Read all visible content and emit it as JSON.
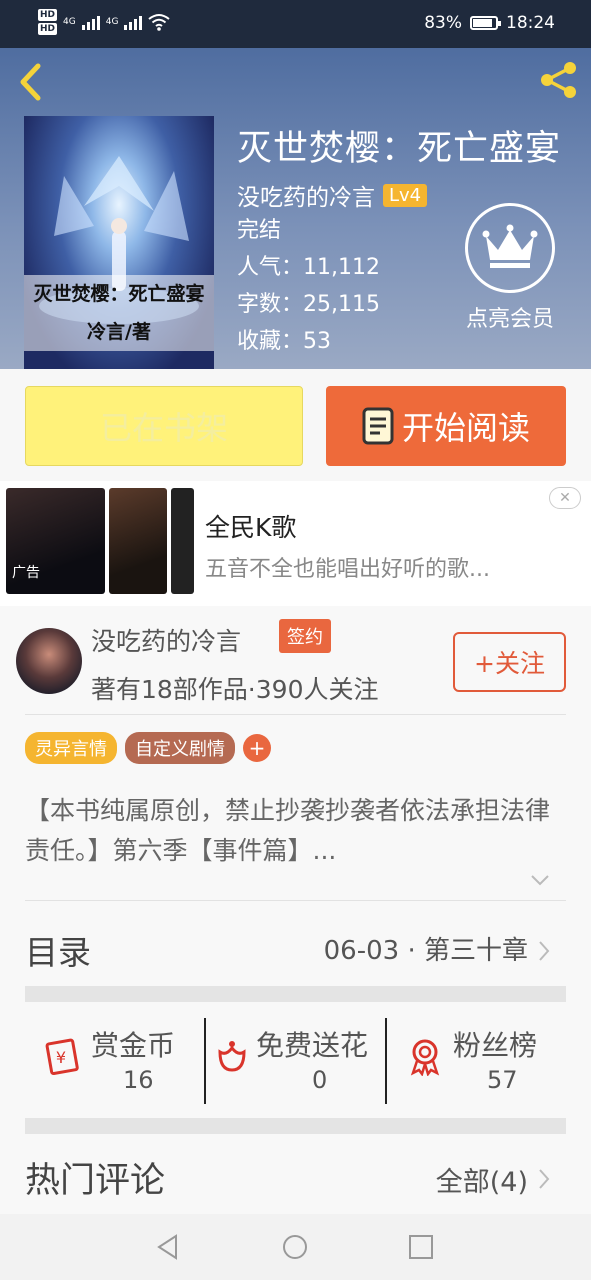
{
  "status_bar": {
    "hd1": "HD",
    "hd2": "HD",
    "net1": "4G",
    "net2": "4G",
    "battery": "83%",
    "time": "18:24"
  },
  "book": {
    "title": "灭世焚樱：死亡盛宴",
    "author": "没吃药的冷言",
    "level": "Lv4",
    "status": "完结",
    "popularity": "人气：11,112",
    "word_count": "字数：25,115",
    "favorites": "收藏：53",
    "cover_text_title": "灭世焚樱：死亡盛宴",
    "cover_text_author": "冷言/著"
  },
  "member": {
    "label": "点亮会员"
  },
  "actions": {
    "shelf_label": "已在书架",
    "read_label": "开始阅读"
  },
  "ad": {
    "title": "全民K歌",
    "desc": "五音不全也能唱出好听的歌...",
    "label": "广告",
    "close": "✕"
  },
  "author_card": {
    "name": "没吃药的冷言",
    "sign_badge": "签约",
    "stats": "著有18部作品·390人关注",
    "follow_label": "+关注"
  },
  "tags": [
    {
      "label": "灵异言情",
      "color": "#f5b530"
    },
    {
      "label": "自定义剧情",
      "color": "#b56a52"
    },
    {
      "label": "+",
      "color": "#e9673f"
    }
  ],
  "description": "【本书纯属原创，禁止抄袭抄袭者依法承担法律责任。】第六季【事件篇】...",
  "toc": {
    "title": "目录",
    "latest": "06-03 · 第三十章"
  },
  "rewards": [
    {
      "label": "赏金币",
      "value": "16",
      "icon": "red-envelope-icon"
    },
    {
      "label": "免费送花",
      "value": "0",
      "icon": "flower-icon"
    },
    {
      "label": "粉丝榜",
      "value": "57",
      "icon": "medal-icon"
    }
  ],
  "comments": {
    "title": "热门评论",
    "all_label": "全部(4)"
  },
  "colors": {
    "accent": "#ee6a3a",
    "shelf_yellow": "#fff27a",
    "red_icon": "#d9342b"
  }
}
